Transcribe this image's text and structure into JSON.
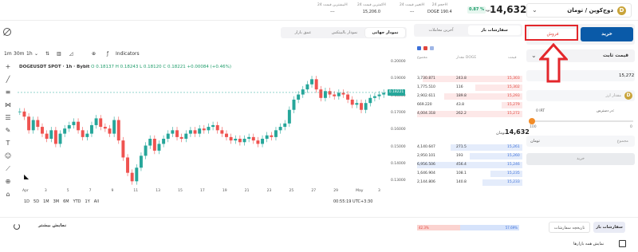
{
  "header": {
    "pair_label": "دوج‌کوین / تومان",
    "coin_letter": "D",
    "last_price": "14,632",
    "price_currency": "تومان",
    "change_pct": "0.87 %",
    "stats": [
      {
        "label": "حجم 24H",
        "value": "DOGE 190.4"
      },
      {
        "label": "تغییر قیمت 24H",
        "value": "---"
      },
      {
        "label": "کمترین قیمت 24H",
        "value": "15,206.0"
      },
      {
        "label": "بیشترین قیمت 24H",
        "value": "---"
      }
    ]
  },
  "chart_tabs": [
    {
      "label": "نمودار جهانی",
      "active": true
    },
    {
      "label": "نمودار بالبیتکس",
      "active": false
    },
    {
      "label": "عمق بازار",
      "active": false
    }
  ],
  "chart_toolbar": {
    "intervals": [
      "1m",
      "30m",
      "1h"
    ],
    "indicators_label": "Indicators"
  },
  "chart_data": {
    "type": "candlestick",
    "symbol": "DOGEUSDT SPOT · 1h · Bybit",
    "ohlc": "O 0.18137  H 0.18243  L 0.18120  C 0.18221  +0.00084 (+0.46%)",
    "last_label": "0.18221",
    "ylim": [
      0.125,
      0.2
    ],
    "y_ticks": [
      "0.20000",
      "0.19000",
      "0.18000",
      "0.17000",
      "0.16000",
      "0.15000",
      "0.14000",
      "0.13000"
    ],
    "x_ticks": [
      "Apr",
      "3",
      "5",
      "7",
      "9",
      "11",
      "13",
      "15",
      "17",
      "19",
      "21",
      "23",
      "25",
      "27",
      "29",
      "May",
      "3"
    ],
    "series": [
      {
        "values": [
          0.171,
          0.168,
          0.16,
          0.166,
          0.162,
          0.158,
          0.155,
          0.16,
          0.152,
          0.158,
          0.161,
          0.163,
          0.165,
          0.16,
          0.156,
          0.158,
          0.163,
          0.167,
          0.162,
          0.161,
          0.158,
          0.166,
          0.154,
          0.144,
          0.135,
          0.13,
          0.138,
          0.145,
          0.151,
          0.155,
          0.148,
          0.152,
          0.155,
          0.158,
          0.16,
          0.156,
          0.155,
          0.158,
          0.16,
          0.158,
          0.161,
          0.16,
          0.162,
          0.163,
          0.16,
          0.158,
          0.156,
          0.154,
          0.155,
          0.153,
          0.155,
          0.156,
          0.154,
          0.152,
          0.155,
          0.157,
          0.156,
          0.16,
          0.162,
          0.164,
          0.172,
          0.178,
          0.181,
          0.184,
          0.187,
          0.19,
          0.184,
          0.179,
          0.183,
          0.181,
          0.18,
          0.182,
          0.181,
          0.178,
          0.175,
          0.176,
          0.172,
          0.176,
          0.179,
          0.18,
          0.181,
          0.182
        ]
      }
    ]
  },
  "chart_bottom": {
    "ranges": [
      "1D",
      "5D",
      "1M",
      "3M",
      "6M",
      "YTD",
      "1Y",
      "All"
    ],
    "clock": "00:55:19 UTC+3:30"
  },
  "orderbook": {
    "tabs": [
      {
        "label": "سفارشات باز",
        "active": true
      },
      {
        "label": "آخرین معاملات",
        "active": false
      }
    ],
    "headers": [
      "قیمت",
      "مقدار DOGE",
      "مجموع"
    ],
    "asks": [
      {
        "total": "3,730.871",
        "amount": "243.8",
        "price": "15,303",
        "depth": 0.95
      },
      {
        "total": "1,775.510",
        "amount": "116",
        "price": "15,302",
        "depth": 0.45
      },
      {
        "total": "2,902.611",
        "amount": "189.8",
        "price": "15,293",
        "depth": 0.74
      },
      {
        "total": "669.220",
        "amount": "43.8",
        "price": "15,279",
        "depth": 0.2
      },
      {
        "total": "4,004.318",
        "amount": "262.2",
        "price": "15,272",
        "depth": 1.0
      }
    ],
    "mid_price": "14,632",
    "mid_currency": "تومان",
    "bids": [
      {
        "total": "4,140.647",
        "amount": "271.5",
        "price": "15,261",
        "depth": 0.68
      },
      {
        "total": "2,950.101",
        "amount": "193",
        "price": "15,260",
        "depth": 0.5
      },
      {
        "total": "6,956.506",
        "amount": "456.4",
        "price": "15,246",
        "depth": 1.0
      },
      {
        "total": "1,646.904",
        "amount": "108.1",
        "price": "15,235",
        "depth": 0.3
      },
      {
        "total": "2,144.806",
        "amount": "140.8",
        "price": "15,233",
        "depth": 0.38
      }
    ],
    "sell_ratio": "42.3%",
    "buy_ratio": "57.69%",
    "sell_fraction": 0.423
  },
  "trade_form": {
    "buy_label": "خرید",
    "sell_label": "فروش",
    "order_type": "قیمت ثابت",
    "price_value": "15,272",
    "amount_placeholder": "مقدار ارز",
    "available_label": "در دسترس:",
    "available_value": "0 IRT",
    "slider_min": "0",
    "slider_max": "100",
    "total_placeholder": "مجموع",
    "total_currency": "تومان",
    "submit_label": "خرید"
  },
  "bottom": {
    "tabs": [
      {
        "label": "سفارشات باز",
        "active": true
      },
      {
        "label": "تاریخچه سفارشات",
        "active": false
      }
    ],
    "show_more": "نمایش بیشتر",
    "show_all_markets": "نمایش همه بازارها"
  }
}
